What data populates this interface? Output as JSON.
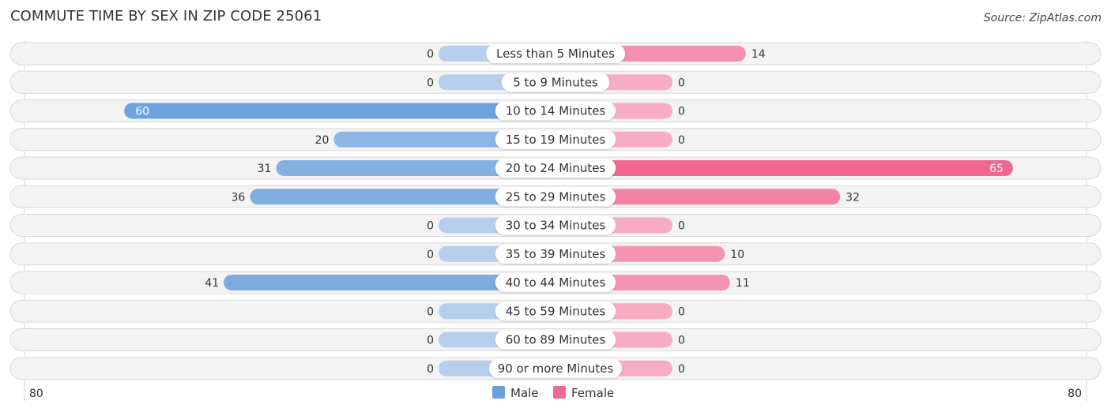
{
  "header": {
    "title": "COMMUTE TIME BY SEX IN ZIP CODE 25061",
    "source": "Source: ZipAtlas.com"
  },
  "chart_data": {
    "type": "bar",
    "orientation": "horizontal-diverging",
    "title": "COMMUTE TIME BY SEX IN ZIP CODE 25061",
    "categories": [
      "Less than 5 Minutes",
      "5 to 9 Minutes",
      "10 to 14 Minutes",
      "15 to 19 Minutes",
      "20 to 24 Minutes",
      "25 to 29 Minutes",
      "30 to 34 Minutes",
      "35 to 39 Minutes",
      "40 to 44 Minutes",
      "45 to 59 Minutes",
      "60 to 89 Minutes",
      "90 or more Minutes"
    ],
    "series": [
      {
        "name": "Male",
        "color": "#6a9fdb",
        "values": [
          0,
          0,
          60,
          20,
          31,
          36,
          0,
          0,
          41,
          0,
          0,
          0
        ]
      },
      {
        "name": "Female",
        "color": "#f06892",
        "values": [
          14,
          0,
          0,
          0,
          65,
          32,
          0,
          10,
          11,
          0,
          0,
          0
        ]
      }
    ],
    "axis": {
      "left_label": "80",
      "right_label": "80",
      "max": 80
    },
    "legend": {
      "position": "bottom-center",
      "items": [
        "Male",
        "Female"
      ]
    }
  }
}
